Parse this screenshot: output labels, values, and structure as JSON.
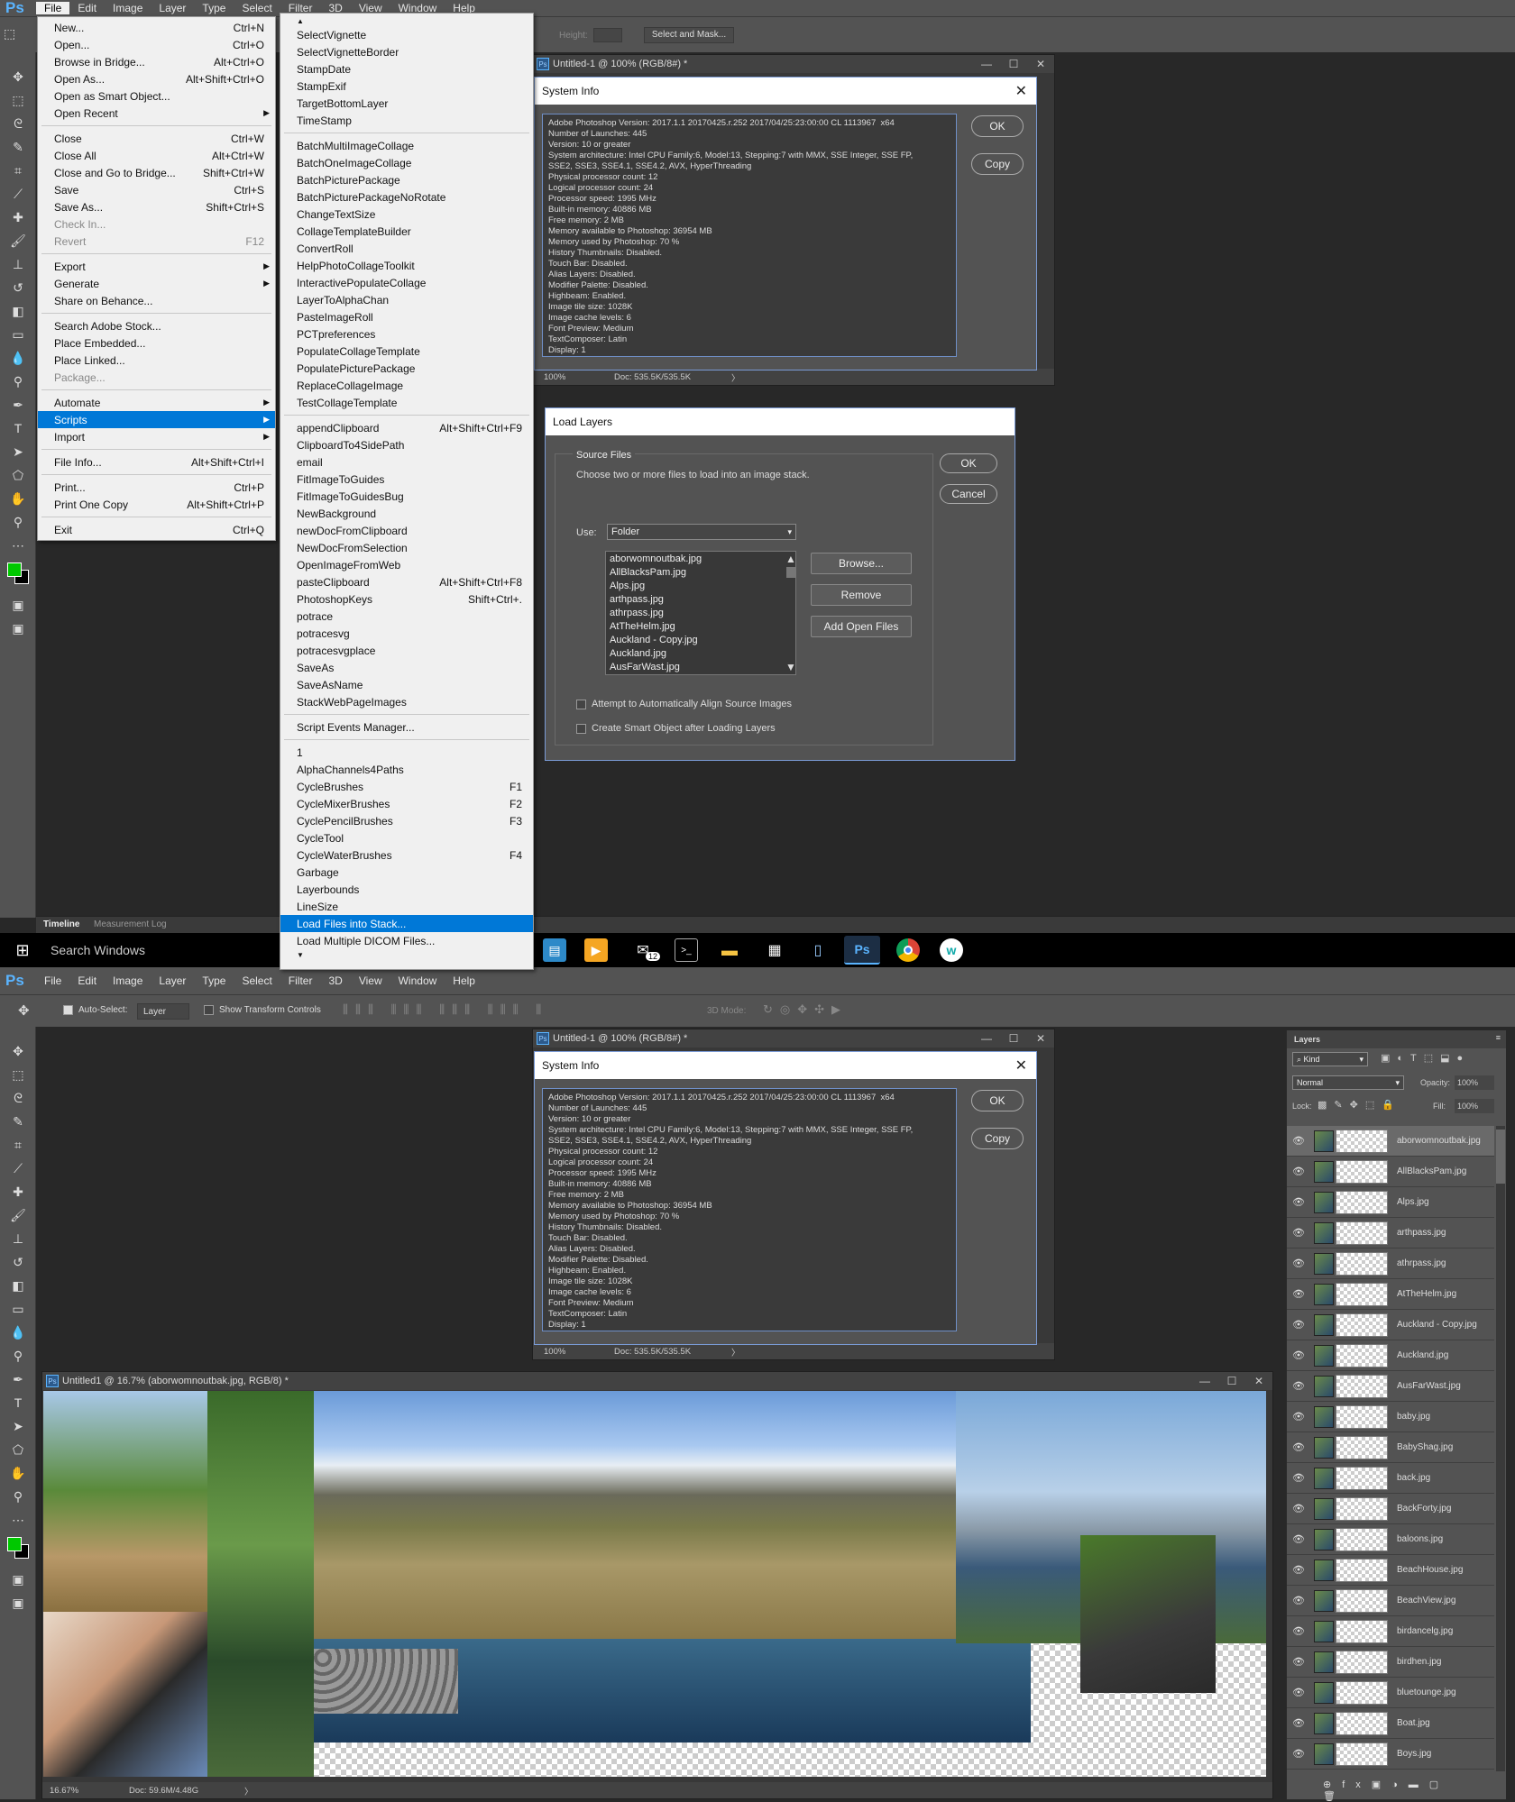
{
  "app": {
    "logo": "Ps"
  },
  "menubar": [
    "File",
    "Edit",
    "Image",
    "Layer",
    "Type",
    "Select",
    "Filter",
    "3D",
    "View",
    "Window",
    "Help"
  ],
  "file_menu": [
    {
      "label": "New...",
      "sc": "Ctrl+N"
    },
    {
      "label": "Open...",
      "sc": "Ctrl+O"
    },
    {
      "label": "Browse in Bridge...",
      "sc": "Alt+Ctrl+O"
    },
    {
      "label": "Open As...",
      "sc": "Alt+Shift+Ctrl+O"
    },
    {
      "label": "Open as Smart Object...",
      "sc": ""
    },
    {
      "label": "Open Recent",
      "sc": "",
      "sub": true
    },
    {
      "sep": true
    },
    {
      "label": "Close",
      "sc": "Ctrl+W"
    },
    {
      "label": "Close All",
      "sc": "Alt+Ctrl+W"
    },
    {
      "label": "Close and Go to Bridge...",
      "sc": "Shift+Ctrl+W"
    },
    {
      "label": "Save",
      "sc": "Ctrl+S"
    },
    {
      "label": "Save As...",
      "sc": "Shift+Ctrl+S"
    },
    {
      "label": "Check In...",
      "sc": "",
      "dis": true
    },
    {
      "label": "Revert",
      "sc": "F12",
      "dis": true
    },
    {
      "sep": true
    },
    {
      "label": "Export",
      "sc": "",
      "sub": true
    },
    {
      "label": "Generate",
      "sc": "",
      "sub": true
    },
    {
      "label": "Share on Behance...",
      "sc": ""
    },
    {
      "sep": true
    },
    {
      "label": "Search Adobe Stock...",
      "sc": ""
    },
    {
      "label": "Place Embedded...",
      "sc": ""
    },
    {
      "label": "Place Linked...",
      "sc": ""
    },
    {
      "label": "Package...",
      "sc": "",
      "dis": true
    },
    {
      "sep": true
    },
    {
      "label": "Automate",
      "sc": "",
      "sub": true
    },
    {
      "label": "Scripts",
      "sc": "",
      "sub": true,
      "hl": true
    },
    {
      "label": "Import",
      "sc": "",
      "sub": true
    },
    {
      "sep": true
    },
    {
      "label": "File Info...",
      "sc": "Alt+Shift+Ctrl+I"
    },
    {
      "sep": true
    },
    {
      "label": "Print...",
      "sc": "Ctrl+P"
    },
    {
      "label": "Print One Copy",
      "sc": "Alt+Shift+Ctrl+P"
    },
    {
      "sep": true
    },
    {
      "label": "Exit",
      "sc": "Ctrl+Q"
    }
  ],
  "scripts_menu": [
    {
      "label": "▲",
      "sc": "",
      "arrow": true
    },
    {
      "label": "SelectVignette",
      "sc": ""
    },
    {
      "label": "SelectVignetteBorder",
      "sc": ""
    },
    {
      "label": "StampDate",
      "sc": ""
    },
    {
      "label": "StampExif",
      "sc": ""
    },
    {
      "label": "TargetBottomLayer",
      "sc": ""
    },
    {
      "label": "TimeStamp",
      "sc": ""
    },
    {
      "sep": true
    },
    {
      "label": "BatchMultiImageCollage",
      "sc": ""
    },
    {
      "label": "BatchOneImageCollage",
      "sc": ""
    },
    {
      "label": "BatchPicturePackage",
      "sc": ""
    },
    {
      "label": "BatchPicturePackageNoRotate",
      "sc": ""
    },
    {
      "label": "ChangeTextSize",
      "sc": ""
    },
    {
      "label": "CollageTemplateBuilder",
      "sc": ""
    },
    {
      "label": "ConvertRoll",
      "sc": ""
    },
    {
      "label": "HelpPhotoCollageToolkit",
      "sc": ""
    },
    {
      "label": "InteractivePopulateCollage",
      "sc": ""
    },
    {
      "label": "LayerToAlphaChan",
      "sc": ""
    },
    {
      "label": "PasteImageRoll",
      "sc": ""
    },
    {
      "label": "PCTpreferences",
      "sc": ""
    },
    {
      "label": "PopulateCollageTemplate",
      "sc": ""
    },
    {
      "label": "PopulatePicturePackage",
      "sc": ""
    },
    {
      "label": "ReplaceCollageImage",
      "sc": ""
    },
    {
      "label": "TestCollageTemplate",
      "sc": ""
    },
    {
      "sep": true
    },
    {
      "label": "appendClipboard",
      "sc": "Alt+Shift+Ctrl+F9"
    },
    {
      "label": "ClipboardTo4SidePath",
      "sc": ""
    },
    {
      "label": "email",
      "sc": ""
    },
    {
      "label": "FitImageToGuides",
      "sc": ""
    },
    {
      "label": "FitImageToGuidesBug",
      "sc": ""
    },
    {
      "label": "NewBackground",
      "sc": ""
    },
    {
      "label": "newDocFromClipboard",
      "sc": ""
    },
    {
      "label": "NewDocFromSelection",
      "sc": ""
    },
    {
      "label": "OpenImageFromWeb",
      "sc": ""
    },
    {
      "label": "pasteClipboard",
      "sc": "Alt+Shift+Ctrl+F8"
    },
    {
      "label": "PhotoshopKeys",
      "sc": "Shift+Ctrl+."
    },
    {
      "label": "potrace",
      "sc": ""
    },
    {
      "label": "potracesvg",
      "sc": ""
    },
    {
      "label": "potracesvgplace",
      "sc": ""
    },
    {
      "label": "SaveAs",
      "sc": ""
    },
    {
      "label": "SaveAsName",
      "sc": ""
    },
    {
      "label": "StackWebPageImages",
      "sc": ""
    },
    {
      "sep": true
    },
    {
      "label": "Script Events Manager...",
      "sc": ""
    },
    {
      "sep": true
    },
    {
      "label": "1",
      "sc": ""
    },
    {
      "label": "AlphaChannels4Paths",
      "sc": ""
    },
    {
      "label": "CycleBrushes",
      "sc": "F1"
    },
    {
      "label": "CycleMixerBrushes",
      "sc": "F2"
    },
    {
      "label": "CyclePencilBrushes",
      "sc": "F3"
    },
    {
      "label": "CycleTool",
      "sc": ""
    },
    {
      "label": "CycleWaterBrushes",
      "sc": "F4"
    },
    {
      "label": "Garbage",
      "sc": ""
    },
    {
      "label": "Layerbounds",
      "sc": ""
    },
    {
      "label": "LineSize",
      "sc": ""
    },
    {
      "label": "Load Files into Stack...",
      "sc": "",
      "hl": true
    },
    {
      "label": "Load Multiple DICOM Files...",
      "sc": ""
    },
    {
      "label": "▼",
      "sc": "",
      "arrow": true
    }
  ],
  "optbar_top": {
    "height_label": "Height:",
    "select_mask": "Select and Mask..."
  },
  "doc1": {
    "title": "Untitled-1 @ 100% (RGB/8#) *",
    "zoom": "100%",
    "doc": "Doc: 535.5K/535.5K"
  },
  "sysinfo": {
    "title": "System Info",
    "ok": "OK",
    "copy": "Copy",
    "text": "Adobe Photoshop Version: 2017.1.1 20170425.r.252 2017/04/25:23:00:00 CL 1113967  x64\nNumber of Launches: 445\nVersion: 10 or greater\nSystem architecture: Intel CPU Family:6, Model:13, Stepping:7 with MMX, SSE Integer, SSE FP,\nSSE2, SSE3, SSE4.1, SSE4.2, AVX, HyperThreading\nPhysical processor count: 12\nLogical processor count: 24\nProcessor speed: 1995 MHz\nBuilt-in memory: 40886 MB\nFree memory: 2 MB\nMemory available to Photoshop: 36954 MB\nMemory used by Photoshop: 70 %\nHistory Thumbnails: Disabled.\nTouch Bar: Disabled.\nAlias Layers: Disabled.\nModifier Palette: Disabled.\nHighbeam: Enabled.\nImage tile size: 1028K\nImage cache levels: 6\nFont Preview: Medium\nTextComposer: Latin\nDisplay: 1"
  },
  "load_layers": {
    "title": "Load Layers",
    "source_files": "Source Files",
    "hint": "Choose two or more files to load into an image stack.",
    "use_label": "Use:",
    "use_value": "Folder",
    "ok": "OK",
    "cancel": "Cancel",
    "browse": "Browse...",
    "remove": "Remove",
    "add_open": "Add Open Files",
    "files": [
      "aborwomnoutbak.jpg",
      "AllBlacksPam.jpg",
      "Alps.jpg",
      "arthpass.jpg",
      "athrpass.jpg",
      "AtTheHelm.jpg",
      "Auckland - Copy.jpg",
      "Auckland.jpg",
      "AusFarWast.jpg"
    ],
    "align": "Attempt to Automatically Align Source Images",
    "smart": "Create Smart Object after Loading Layers"
  },
  "panel_tabs": {
    "timeline": "Timeline",
    "measurement": "Measurement Log"
  },
  "taskbar": {
    "search": "Search Windows",
    "badge": "12"
  },
  "optbar_bottom": {
    "auto_select": "Auto-Select:",
    "layer": "Layer",
    "show_transform": "Show Transform Controls",
    "mode_3d": "3D Mode:"
  },
  "doc2": {
    "title": "Untitled-1 @ 100% (RGB/8#) *",
    "zoom": "100%",
    "doc": "Doc: 535.5K/535.5K"
  },
  "doc3": {
    "title": "Untitled1 @ 16.7% (aborwomnoutbak.jpg, RGB/8) *",
    "zoom": "16.67%",
    "doc": "Doc: 59.6M/4.48G"
  },
  "layers_panel": {
    "title": "Layers",
    "kind": "Kind",
    "blend": "Normal",
    "opacity_label": "Opacity:",
    "opacity": "100%",
    "lock_label": "Lock:",
    "fill_label": "Fill:",
    "fill": "100%",
    "layers": [
      "aborwomnoutbak.jpg",
      "AllBlacksPam.jpg",
      "Alps.jpg",
      "arthpass.jpg",
      "athrpass.jpg",
      "AtTheHelm.jpg",
      "Auckland - Copy.jpg",
      "Auckland.jpg",
      "AusFarWast.jpg",
      "baby.jpg",
      "BabyShag.jpg",
      "back.jpg",
      "BackForty.jpg",
      "baloons.jpg",
      "BeachHouse.jpg",
      "BeachView.jpg",
      "birdancelg.jpg",
      "birdhen.jpg",
      "bluetounge.jpg",
      "Boat.jpg",
      "Boys.jpg"
    ]
  },
  "colors": {
    "accent": "#0078d7",
    "fg_swatch": "#00c800",
    "panel": "#535353",
    "bg": "#282828"
  }
}
